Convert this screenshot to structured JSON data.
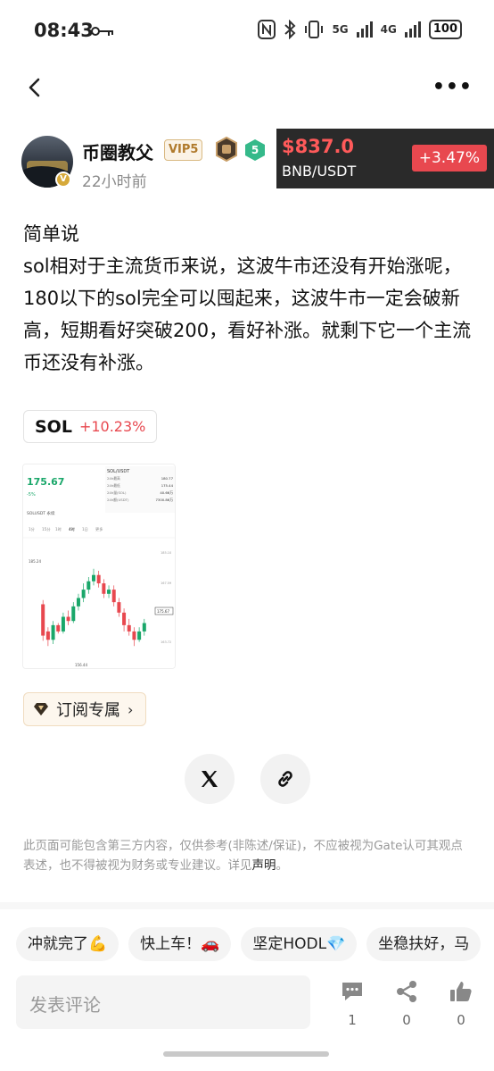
{
  "status_bar": {
    "time": "08:43",
    "net1": "5G",
    "net2": "4G",
    "battery": "100"
  },
  "nav": {
    "back_icon": "chevron-left-icon",
    "more_icon": "more-dots-icon"
  },
  "author": {
    "name": "币圈教父",
    "vip": "VIP5",
    "time": "22小时前",
    "verified_badge": "V",
    "level_badge": "5"
  },
  "ticker": {
    "price": "$837.0",
    "pair": "BNB/USDT",
    "change": "+3.47%",
    "price_color": "#ff5a5a",
    "change_color": "#e8484f"
  },
  "post": {
    "lines": [
      "简单说",
      "sol相对于主流货币来说，这波牛市还没有开始涨呢，180以下的sol完全可以囤起来，这波牛市一定会破新高，短期看好突破200，看好补涨。就剩下它一个主流币还没有补涨。"
    ]
  },
  "coin_tag": {
    "symbol": "SOL",
    "change": "+10.23%"
  },
  "screenshot": {
    "price": "175.67",
    "pct": "-5%",
    "pair_label": "SOL/USDT",
    "pair_row": "SOLUSDT 永续",
    "tabs": [
      "1分",
      "15分",
      "1时",
      "4时",
      "1日",
      "更多"
    ],
    "stats": [
      [
        "24h最高",
        "180.77"
      ],
      [
        "24h最低",
        "175.44"
      ],
      [
        "24h量(SOL)",
        "40.66万"
      ],
      [
        "24h额(USDT)",
        "7300.86万"
      ]
    ],
    "high_label": "185.24",
    "low_label": "156.44",
    "last_label": "175.67",
    "axis_labels": [
      "185.10",
      "167.59",
      "163.72"
    ],
    "candles": [
      [
        0.1,
        0.56,
        0.26,
        0.21,
        0.6
      ],
      [
        0.14,
        0.3,
        0.22,
        0.16,
        0.34
      ],
      [
        0.18,
        0.22,
        0.36,
        0.18,
        0.4
      ],
      [
        0.22,
        0.36,
        0.3,
        0.28,
        0.38
      ],
      [
        0.26,
        0.3,
        0.44,
        0.28,
        0.48
      ],
      [
        0.3,
        0.44,
        0.4,
        0.36,
        0.5
      ],
      [
        0.34,
        0.4,
        0.54,
        0.38,
        0.58
      ],
      [
        0.38,
        0.54,
        0.62,
        0.5,
        0.66
      ],
      [
        0.42,
        0.62,
        0.7,
        0.58,
        0.76
      ],
      [
        0.46,
        0.7,
        0.78,
        0.66,
        0.82
      ],
      [
        0.5,
        0.78,
        0.84,
        0.74,
        0.9
      ],
      [
        0.54,
        0.84,
        0.76,
        0.72,
        0.88
      ],
      [
        0.58,
        0.76,
        0.66,
        0.62,
        0.8
      ],
      [
        0.62,
        0.66,
        0.7,
        0.62,
        0.74
      ],
      [
        0.66,
        0.7,
        0.58,
        0.54,
        0.74
      ],
      [
        0.7,
        0.58,
        0.48,
        0.44,
        0.62
      ],
      [
        0.74,
        0.48,
        0.36,
        0.3,
        0.52
      ],
      [
        0.78,
        0.36,
        0.3,
        0.26,
        0.42
      ],
      [
        0.82,
        0.3,
        0.22,
        0.16,
        0.34
      ],
      [
        0.86,
        0.22,
        0.3,
        0.2,
        0.34
      ],
      [
        0.9,
        0.3,
        0.38,
        0.26,
        0.42
      ]
    ]
  },
  "subscribe": {
    "label": "订阅专属",
    "icon": "diamond-icon"
  },
  "share": {
    "x_icon": "x-logo-icon",
    "link_icon": "link-icon"
  },
  "disclaimer": {
    "text": "此页面可能包含第三方内容，仅供参考(非陈述/保证)，不应被视为Gate认可其观点表述，也不得被视为财务或专业建议。详见",
    "link": "声明",
    "end": "。"
  },
  "chips": [
    "冲就完了💪",
    "快上车！🚗",
    "坚定HODL💎",
    "坐稳扶好，马"
  ],
  "comment": {
    "placeholder": "发表评论"
  },
  "actions": [
    {
      "icon": "comment-icon",
      "count": "1"
    },
    {
      "icon": "share-icon",
      "count": "0"
    },
    {
      "icon": "like-icon",
      "count": "0"
    }
  ]
}
